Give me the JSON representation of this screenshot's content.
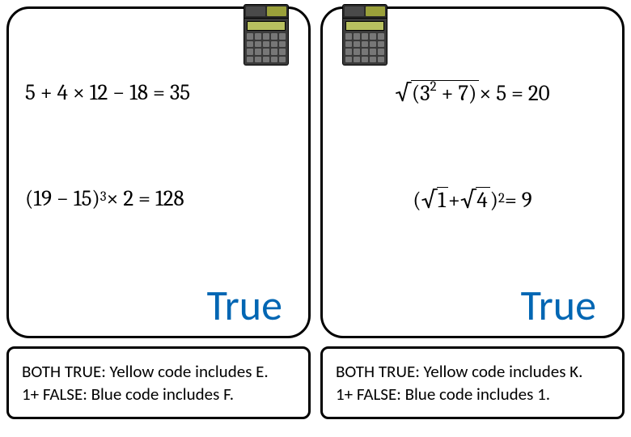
{
  "cards": [
    {
      "eq1_plain": "5 + 4 × 12 − 18 = 35",
      "eq2_base": "(19 − 15)",
      "eq2_exp": "3",
      "eq2_tail": " × 2 = 128",
      "answer": "True"
    },
    {
      "eq1_rad_inner_base": "(3",
      "eq1_rad_inner_exp": "2",
      "eq1_rad_inner_tail": " + 7)",
      "eq1_tail": " × 5 = 20",
      "eq2_lp": "(",
      "eq2_rad1": "1",
      "eq2_plus": " + ",
      "eq2_rad2": "4",
      "eq2_rp": ")",
      "eq2_exp": "2",
      "eq2_tail": " = 9",
      "answer": "True"
    }
  ],
  "hints": [
    {
      "line1": "BOTH TRUE: Yellow code includes E.",
      "line2": "1+ FALSE: Blue code includes F."
    },
    {
      "line1": "BOTH TRUE: Yellow code includes K.",
      "line2": "1+ FALSE: Blue code includes 1."
    }
  ]
}
